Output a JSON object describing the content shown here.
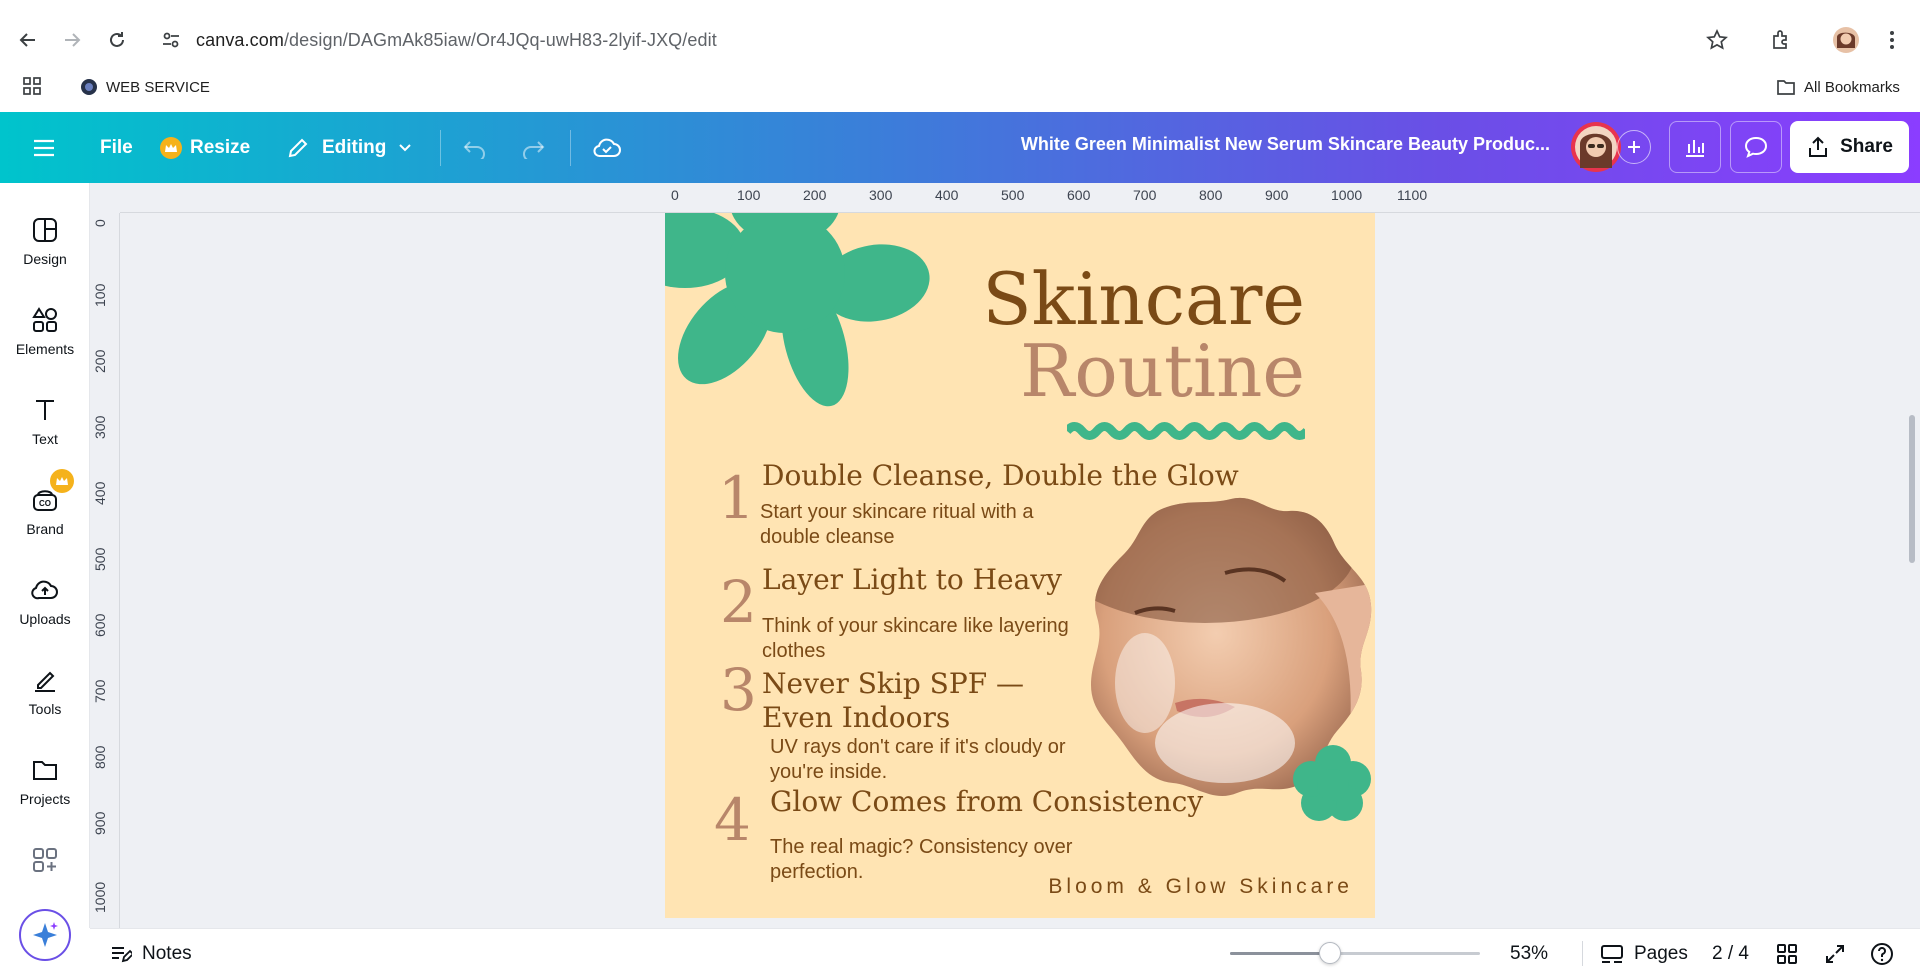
{
  "browser": {
    "url_host": "canva.com",
    "url_path": "/design/DAGmAk85iaw/Or4JQq-uwH83-2lyif-JXQ/edit",
    "bookmark_label": "WEB SERVICE",
    "all_bookmarks_label": "All Bookmarks"
  },
  "topbar": {
    "file_label": "File",
    "resize_label": "Resize",
    "editing_label": "Editing",
    "doc_title": "White Green Minimalist New Serum Skincare Beauty Produc...",
    "share_label": "Share"
  },
  "sidebar": {
    "items": [
      {
        "label": "Design"
      },
      {
        "label": "Elements"
      },
      {
        "label": "Text"
      },
      {
        "label": "Brand"
      },
      {
        "label": "Uploads"
      },
      {
        "label": "Tools"
      },
      {
        "label": "Projects"
      }
    ]
  },
  "rulers": {
    "top": [
      "0",
      "100",
      "200",
      "300",
      "400",
      "500",
      "600",
      "700",
      "800",
      "900",
      "1000",
      "1100"
    ],
    "left": [
      "0",
      "100",
      "200",
      "300",
      "400",
      "500",
      "600",
      "700",
      "800",
      "900",
      "1000"
    ]
  },
  "design": {
    "title_line1": "Skincare",
    "title_line2": "Routine",
    "steps": [
      {
        "num": "1",
        "heading": "Double Cleanse, Double the Glow",
        "body": "Start your skincare ritual with a double cleanse"
      },
      {
        "num": "2",
        "heading": "Layer Light to Heavy",
        "body": "Think of your skincare like layering clothes"
      },
      {
        "num": "3",
        "heading": "Never Skip SPF — Even Indoors",
        "body": "UV rays don't care if it's cloudy or you're inside."
      },
      {
        "num": "4",
        "heading": "Glow Comes from Consistency",
        "body": "The real magic? Consistency over perfection."
      }
    ],
    "brand": "Bloom & Glow Skincare",
    "colors": {
      "bg": "#ffe4b3",
      "accent_green": "#3fb68a",
      "brown": "#7a4a16",
      "rose": "#b8866a"
    }
  },
  "bottombar": {
    "notes_label": "Notes",
    "zoom": "53%",
    "zoom_fraction": 0.4,
    "pages_label": "Pages",
    "page_indicator": "2 / 4"
  }
}
